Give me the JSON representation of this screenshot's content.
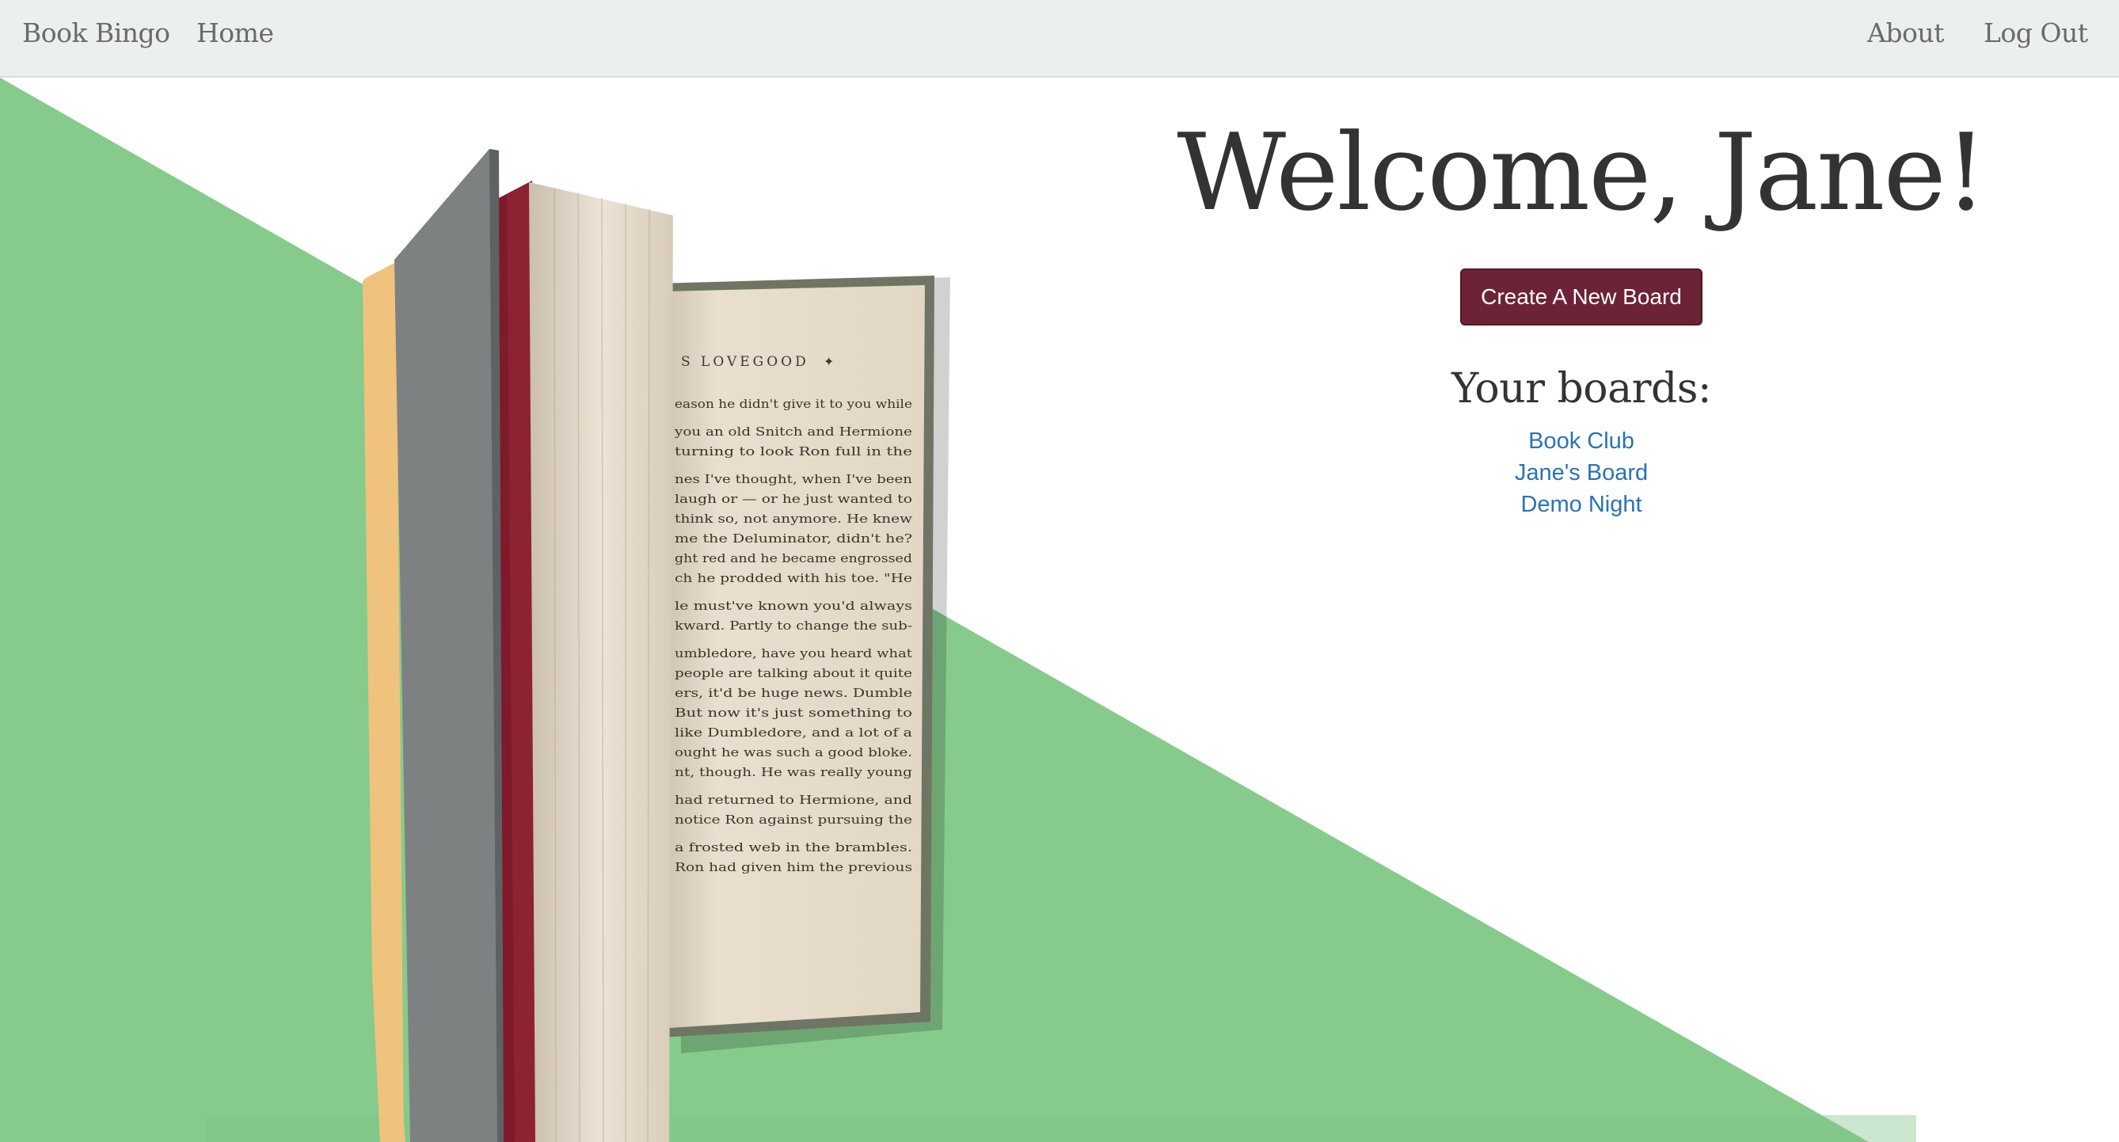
{
  "nav": {
    "brand": "Book Bingo",
    "home": "Home",
    "about": "About",
    "logout": "Log Out"
  },
  "main": {
    "welcome": "Welcome, Jane!",
    "create_button": "Create A New Board",
    "boards_heading": "Your boards:",
    "boards": [
      {
        "label": "Book Club"
      },
      {
        "label": "Jane's Board"
      },
      {
        "label": "Demo Night"
      }
    ]
  },
  "book": {
    "running_head": "S LOVEGOOD",
    "text_lines": [
      "eason he didn't give it to you while",
      "you an old Snitch and Hermione",
      "turning to look Ron full in the",
      "nes I've thought, when I've been",
      "laugh or — or he just wanted to",
      "think so, not anymore. He knew",
      "me the Deluminator, didn't he?",
      "ght red and he became engrossed",
      "ch he prodded with his toe. \"He",
      "le must've known you'd always",
      "kward. Partly to change the sub-",
      "umbledore, have you heard what",
      "people are talking about it quite",
      "ers, it'd be huge news. Dumble",
      "But now it's just something to",
      "like Dumbledore, and a lot of a",
      "ought he was such a good bloke.",
      "nt, though. He was really young",
      "had returned to Hermione, and",
      "notice Ron against pursuing the",
      "a frosted web in the brambles.",
      "Ron had given him the previous"
    ]
  },
  "colors": {
    "navbar_bg": "#eceff0",
    "green": "#86cb8c",
    "button": "#6d2336",
    "link": "#2a72b5",
    "text": "#333333"
  }
}
